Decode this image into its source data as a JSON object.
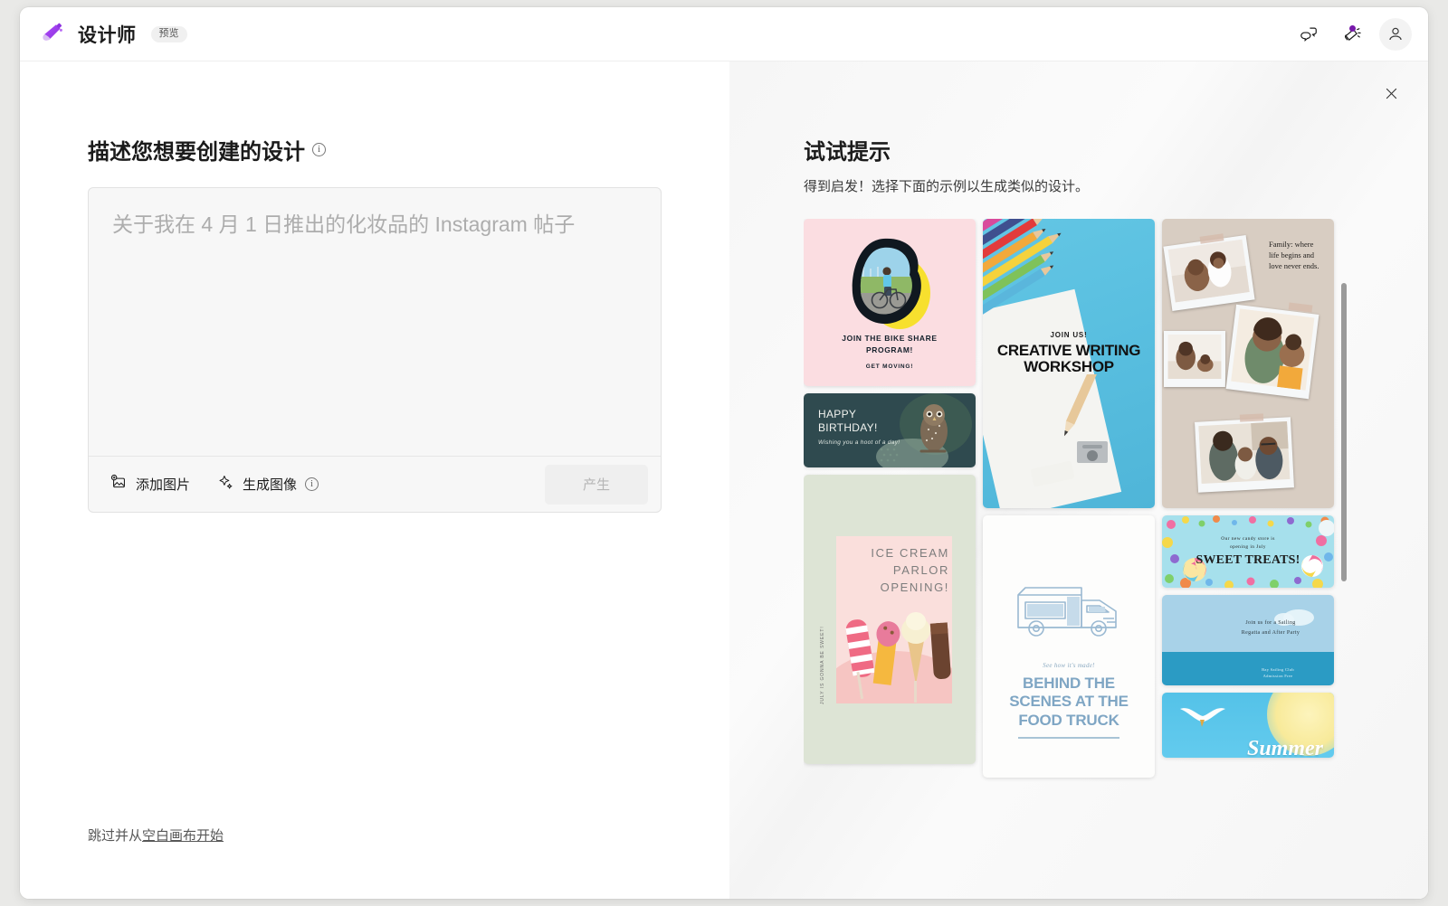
{
  "topbar": {
    "logo_icon": "paintbrush-logo-icon",
    "app_title": "设计师",
    "preview_badge": "预览",
    "feedback_icon": "chat-feedback-icon",
    "announcements_icon": "megaphone-icon",
    "account_icon": "person-avatar-icon"
  },
  "left": {
    "heading": "描述您想要创建的设计",
    "heading_info_icon": "info-icon",
    "prompt_value": "",
    "prompt_placeholder": "关于我在 4 月 1 日推出的化妆品的 Instagram 帖子",
    "add_image_label": "添加图片",
    "add_image_icon": "add-image-icon",
    "generate_image_label": "生成图像",
    "generate_image_icon": "sparkle-icon",
    "generate_image_info_icon": "info-icon",
    "generate_button": "产生",
    "skip_prefix": "跳过并从",
    "skip_link": "空白画布开始"
  },
  "right": {
    "close_icon": "close-icon",
    "title": "试试提示",
    "subtitle": "得到启发！选择下面的示例以生成类似的设计。",
    "gallery": [
      {
        "id": "bike-share",
        "line1": "JOIN THE BIKE SHARE",
        "line2": "PROGRAM!",
        "line3": "GET MOVING!",
        "bg": "#fbdde1"
      },
      {
        "id": "happy-birthday",
        "line1": "HAPPY",
        "line2": "BIRTHDAY!",
        "line3": "Wishing you a hoot of a day!",
        "bg": "#2f4a4f"
      },
      {
        "id": "creative-writing-workshop",
        "line1": "JOIN US!",
        "line2": "CREATIVE WRITING",
        "line3": "WORKSHOP",
        "bg": "#59bfe0"
      },
      {
        "id": "family-collage",
        "quote": "Family: where life begins and love never ends.",
        "bg": "#d8cdc2"
      },
      {
        "id": "ice-cream-parlor",
        "line1": "ICE CREAM",
        "line2": "PARLOR",
        "line3": "OPENING!",
        "vertical": "JULY IS GONNA BE SWEET!",
        "bg": "#dde4d5"
      },
      {
        "id": "food-truck",
        "script": "See how it's made!",
        "line1": "BEHIND THE",
        "line2": "SCENES AT THE",
        "line3": "FOOD TRUCK",
        "bg": "#fdfdfc"
      },
      {
        "id": "sweet-treats",
        "line1": "Our new candy store is",
        "line2": "opening in July",
        "line3": "SWEET TREATS!",
        "bg": "#a6e0ec"
      },
      {
        "id": "sailing-regatta",
        "line1": "Join us for a Sailing",
        "line2": "Regatta and After Party",
        "line3": "Bay Sailing Club",
        "line4": "Admission Free",
        "bg": "#a8d2e8"
      },
      {
        "id": "summer-sale",
        "line1": "Summer",
        "bg": "#54c2e8"
      }
    ]
  }
}
